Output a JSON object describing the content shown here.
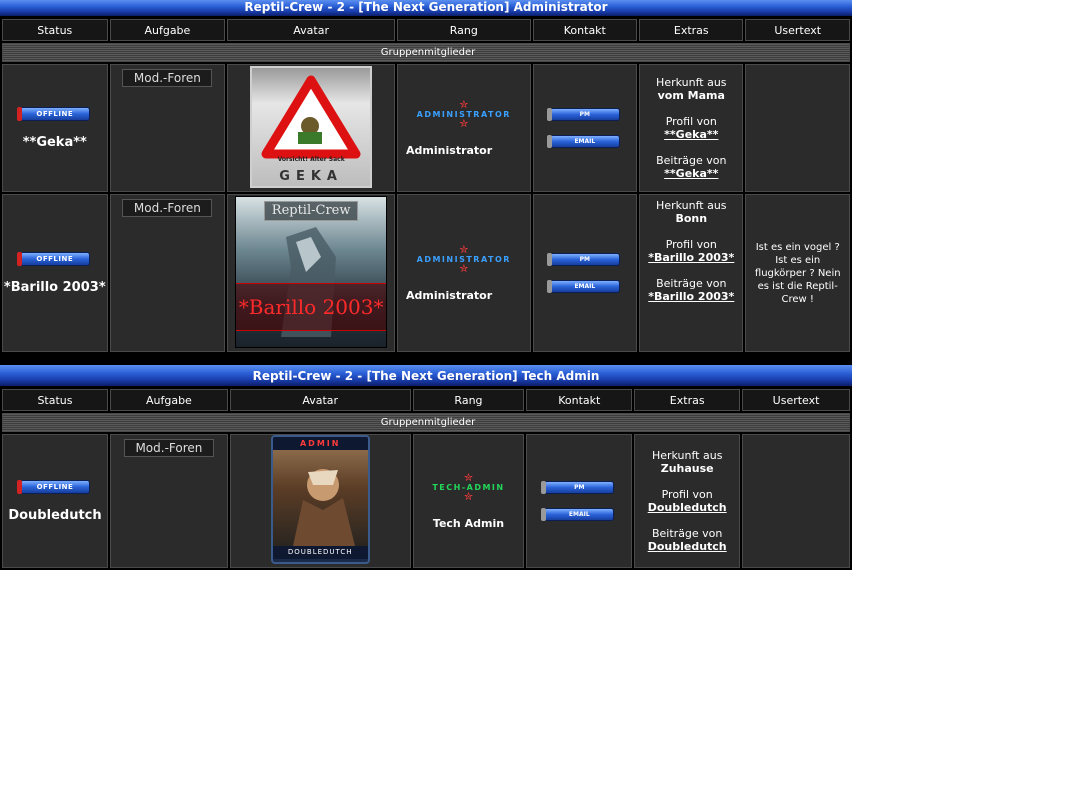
{
  "groups": [
    {
      "title": "Reptil-Crew - 2 - [The Next Generation] Administrator",
      "columns": [
        "Status",
        "Aufgabe",
        "Avatar",
        "Rang",
        "Kontakt",
        "Extras",
        "Usertext"
      ],
      "section_label": "Gruppenmitglieder",
      "members": [
        {
          "status": "OFFLINE",
          "username": "**Geka**",
          "task": "Mod.-Foren",
          "avatar_caption": "GEKA",
          "avatar_subtext": "Vorsicht! Alter Sack",
          "rank_image_text": "ADMINISTRATOR",
          "rank_title": "Administrator",
          "contact": [
            "PM",
            "EMAIL"
          ],
          "origin_label": "Herkunft aus",
          "origin": "vom Mama",
          "profile_label": "Profil von",
          "posts_label": "Beiträge von",
          "usertext": ""
        },
        {
          "status": "OFFLINE",
          "username": "*Barillo 2003*",
          "task": "Mod.-Foren",
          "avatar_caption": "Reptil-Crew",
          "avatar_subtext": "*Barillo 2003*",
          "rank_image_text": "ADMINISTRATOR",
          "rank_title": "Administrator",
          "contact": [
            "PM",
            "EMAIL"
          ],
          "origin_label": "Herkunft aus",
          "origin": "Bonn",
          "profile_label": "Profil von",
          "posts_label": "Beiträge von",
          "usertext": "Ist es ein vogel ? Ist es ein flugkörper ? Nein es ist die Reptil-Crew !"
        }
      ]
    },
    {
      "title": "Reptil-Crew - 2 - [The Next Generation] Tech Admin",
      "columns": [
        "Status",
        "Aufgabe",
        "Avatar",
        "Rang",
        "Kontakt",
        "Extras",
        "Usertext"
      ],
      "section_label": "Gruppenmitglieder",
      "members": [
        {
          "status": "OFFLINE",
          "username": "Doubledutch",
          "task": "Mod.-Foren",
          "avatar_caption": "ADMIN",
          "avatar_subtext": "DOUBLEDUTCH",
          "rank_image_text": "TECH-ADMIN",
          "rank_title": "Tech Admin",
          "contact": [
            "PM",
            "EMAIL"
          ],
          "origin_label": "Herkunft aus",
          "origin": "Zuhause",
          "profile_label": "Profil von",
          "posts_label": "Beiträge von",
          "usertext": ""
        }
      ]
    }
  ],
  "colors": {
    "title_blue": "#2a5fd6",
    "cell_bg": "#2b2b2b",
    "offline_red": "#d32222",
    "admin_rank": "#3aa0ff",
    "tech_rank": "#22d65a"
  }
}
